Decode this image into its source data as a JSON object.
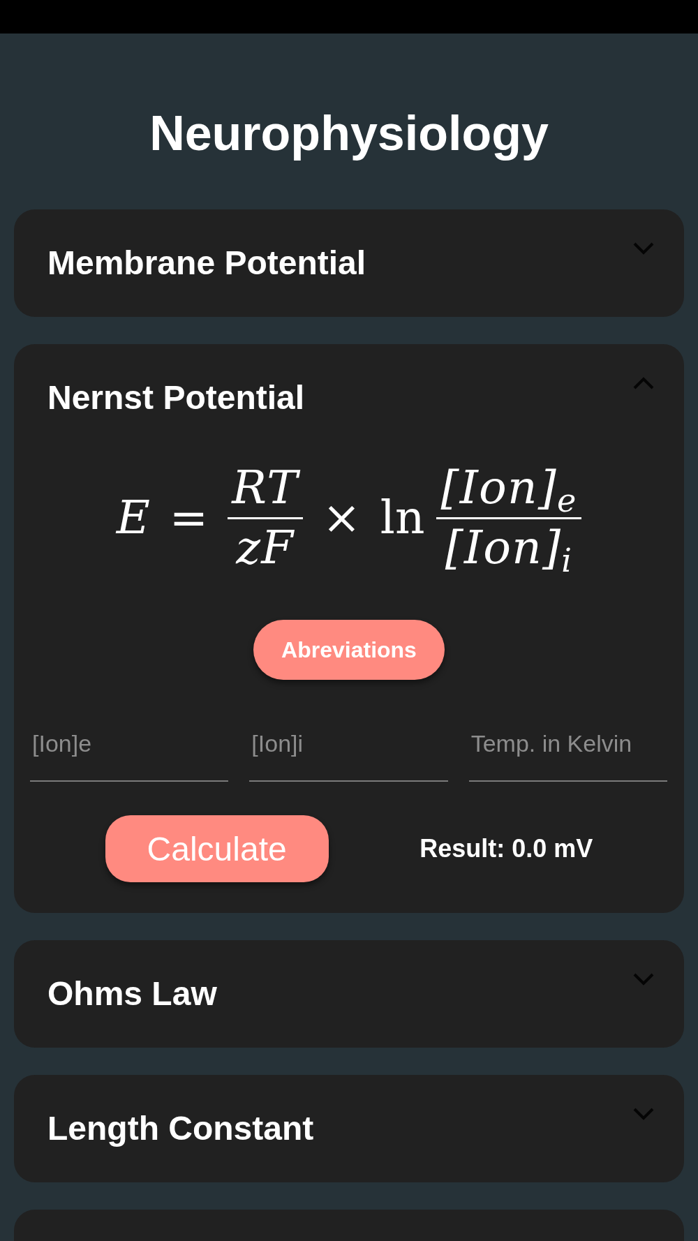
{
  "title": "Neurophysiology",
  "sections": [
    {
      "kind": "accordion",
      "title": "Membrane Potential",
      "expanded": false
    },
    {
      "kind": "accordion",
      "title": "Nernst Potential",
      "expanded": true,
      "formula": [
        {
          "kind": "variable",
          "text": "E"
        },
        {
          "kind": "operator",
          "text": "="
        },
        {
          "kind": "fraction",
          "numerator": "RT",
          "denominator": "zF"
        },
        {
          "kind": "operator",
          "text": "×"
        },
        {
          "kind": "function",
          "text": "ln"
        },
        {
          "kind": "fraction",
          "numerator": "[Ion]$_{e}$",
          "denominator": "[Ion]$_{i}$"
        }
      ],
      "abbreviations_button": "Abreviations",
      "fields": [
        {
          "placeholder": "[Ion]e"
        },
        {
          "placeholder": "[Ion]i"
        },
        {
          "placeholder": "Temp. in Kelvin"
        }
      ],
      "calculate_button": "Calculate",
      "result": "Result: 0.0 mV"
    },
    {
      "kind": "accordion",
      "title": "Ohms Law",
      "expanded": false
    },
    {
      "kind": "accordion",
      "title": "Length Constant",
      "expanded": false
    },
    {
      "kind": "clipped"
    }
  ]
}
